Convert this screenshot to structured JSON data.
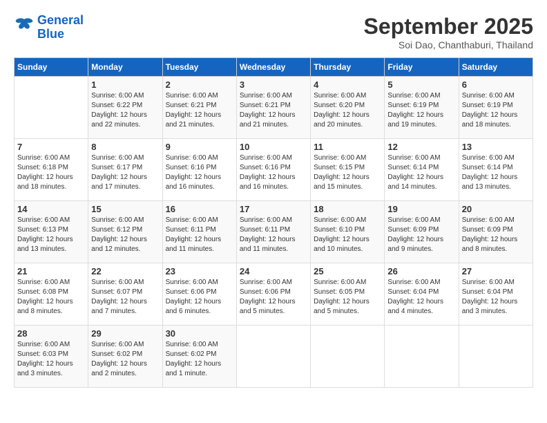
{
  "header": {
    "logo_line1": "General",
    "logo_line2": "Blue",
    "title": "September 2025",
    "subtitle": "Soi Dao, Chanthaburi, Thailand"
  },
  "weekdays": [
    "Sunday",
    "Monday",
    "Tuesday",
    "Wednesday",
    "Thursday",
    "Friday",
    "Saturday"
  ],
  "weeks": [
    [
      {
        "day": "",
        "info": ""
      },
      {
        "day": "1",
        "info": "Sunrise: 6:00 AM\nSunset: 6:22 PM\nDaylight: 12 hours\nand 22 minutes."
      },
      {
        "day": "2",
        "info": "Sunrise: 6:00 AM\nSunset: 6:21 PM\nDaylight: 12 hours\nand 21 minutes."
      },
      {
        "day": "3",
        "info": "Sunrise: 6:00 AM\nSunset: 6:21 PM\nDaylight: 12 hours\nand 21 minutes."
      },
      {
        "day": "4",
        "info": "Sunrise: 6:00 AM\nSunset: 6:20 PM\nDaylight: 12 hours\nand 20 minutes."
      },
      {
        "day": "5",
        "info": "Sunrise: 6:00 AM\nSunset: 6:19 PM\nDaylight: 12 hours\nand 19 minutes."
      },
      {
        "day": "6",
        "info": "Sunrise: 6:00 AM\nSunset: 6:19 PM\nDaylight: 12 hours\nand 18 minutes."
      }
    ],
    [
      {
        "day": "7",
        "info": "Sunrise: 6:00 AM\nSunset: 6:18 PM\nDaylight: 12 hours\nand 18 minutes."
      },
      {
        "day": "8",
        "info": "Sunrise: 6:00 AM\nSunset: 6:17 PM\nDaylight: 12 hours\nand 17 minutes."
      },
      {
        "day": "9",
        "info": "Sunrise: 6:00 AM\nSunset: 6:16 PM\nDaylight: 12 hours\nand 16 minutes."
      },
      {
        "day": "10",
        "info": "Sunrise: 6:00 AM\nSunset: 6:16 PM\nDaylight: 12 hours\nand 16 minutes."
      },
      {
        "day": "11",
        "info": "Sunrise: 6:00 AM\nSunset: 6:15 PM\nDaylight: 12 hours\nand 15 minutes."
      },
      {
        "day": "12",
        "info": "Sunrise: 6:00 AM\nSunset: 6:14 PM\nDaylight: 12 hours\nand 14 minutes."
      },
      {
        "day": "13",
        "info": "Sunrise: 6:00 AM\nSunset: 6:14 PM\nDaylight: 12 hours\nand 13 minutes."
      }
    ],
    [
      {
        "day": "14",
        "info": "Sunrise: 6:00 AM\nSunset: 6:13 PM\nDaylight: 12 hours\nand 13 minutes."
      },
      {
        "day": "15",
        "info": "Sunrise: 6:00 AM\nSunset: 6:12 PM\nDaylight: 12 hours\nand 12 minutes."
      },
      {
        "day": "16",
        "info": "Sunrise: 6:00 AM\nSunset: 6:11 PM\nDaylight: 12 hours\nand 11 minutes."
      },
      {
        "day": "17",
        "info": "Sunrise: 6:00 AM\nSunset: 6:11 PM\nDaylight: 12 hours\nand 11 minutes."
      },
      {
        "day": "18",
        "info": "Sunrise: 6:00 AM\nSunset: 6:10 PM\nDaylight: 12 hours\nand 10 minutes."
      },
      {
        "day": "19",
        "info": "Sunrise: 6:00 AM\nSunset: 6:09 PM\nDaylight: 12 hours\nand 9 minutes."
      },
      {
        "day": "20",
        "info": "Sunrise: 6:00 AM\nSunset: 6:09 PM\nDaylight: 12 hours\nand 8 minutes."
      }
    ],
    [
      {
        "day": "21",
        "info": "Sunrise: 6:00 AM\nSunset: 6:08 PM\nDaylight: 12 hours\nand 8 minutes."
      },
      {
        "day": "22",
        "info": "Sunrise: 6:00 AM\nSunset: 6:07 PM\nDaylight: 12 hours\nand 7 minutes."
      },
      {
        "day": "23",
        "info": "Sunrise: 6:00 AM\nSunset: 6:06 PM\nDaylight: 12 hours\nand 6 minutes."
      },
      {
        "day": "24",
        "info": "Sunrise: 6:00 AM\nSunset: 6:06 PM\nDaylight: 12 hours\nand 5 minutes."
      },
      {
        "day": "25",
        "info": "Sunrise: 6:00 AM\nSunset: 6:05 PM\nDaylight: 12 hours\nand 5 minutes."
      },
      {
        "day": "26",
        "info": "Sunrise: 6:00 AM\nSunset: 6:04 PM\nDaylight: 12 hours\nand 4 minutes."
      },
      {
        "day": "27",
        "info": "Sunrise: 6:00 AM\nSunset: 6:04 PM\nDaylight: 12 hours\nand 3 minutes."
      }
    ],
    [
      {
        "day": "28",
        "info": "Sunrise: 6:00 AM\nSunset: 6:03 PM\nDaylight: 12 hours\nand 3 minutes."
      },
      {
        "day": "29",
        "info": "Sunrise: 6:00 AM\nSunset: 6:02 PM\nDaylight: 12 hours\nand 2 minutes."
      },
      {
        "day": "30",
        "info": "Sunrise: 6:00 AM\nSunset: 6:02 PM\nDaylight: 12 hours\nand 1 minute."
      },
      {
        "day": "",
        "info": ""
      },
      {
        "day": "",
        "info": ""
      },
      {
        "day": "",
        "info": ""
      },
      {
        "day": "",
        "info": ""
      }
    ]
  ]
}
